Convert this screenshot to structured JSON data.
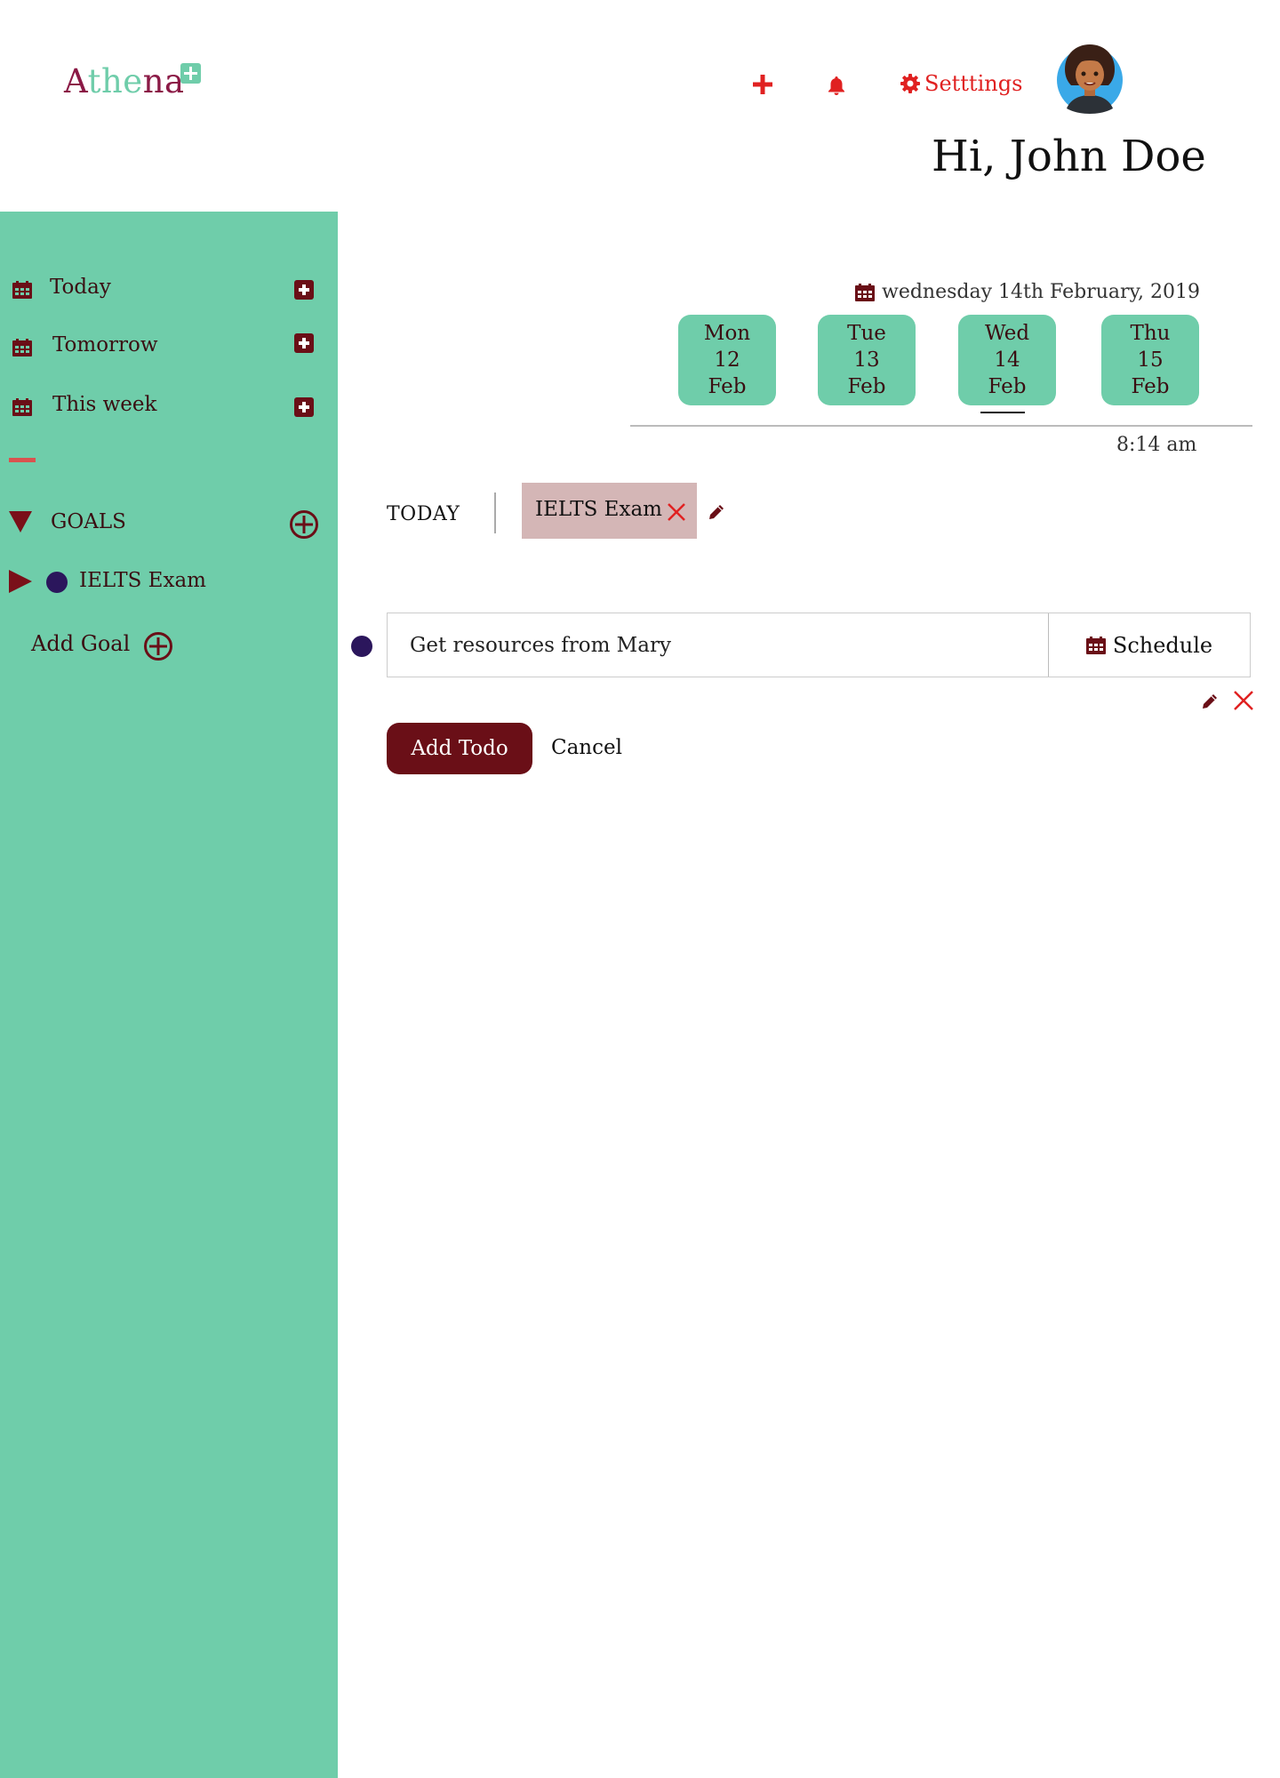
{
  "brand": {
    "logo_part1": "A",
    "logo_part2": "the",
    "logo_part3": "na"
  },
  "header": {
    "add_icon": "plus-icon",
    "notifications_icon": "bell-icon",
    "settings_label": "Setttings",
    "settings_icon": "gear-icon",
    "greeting": "Hi, John Doe"
  },
  "sidebar": {
    "items": [
      {
        "label": "Today",
        "icon": "calendar-icon"
      },
      {
        "label": "Tomorrow",
        "icon": "calendar-icon"
      },
      {
        "label": "This week",
        "icon": "calendar-icon"
      }
    ],
    "goals_label": "GOALS",
    "goals": [
      {
        "label": "IELTS Exam",
        "color": "#2b165c"
      }
    ],
    "add_goal_label": "Add Goal"
  },
  "main": {
    "current_date": "wednesday 14th February, 2019",
    "days": [
      {
        "dow": "Mon",
        "date": "12",
        "month": "Feb"
      },
      {
        "dow": "Tue",
        "date": "13",
        "month": "Feb"
      },
      {
        "dow": "Wed",
        "date": "14",
        "month": "Feb",
        "selected": true
      },
      {
        "dow": "Thu",
        "date": "15",
        "month": "Feb"
      }
    ],
    "time": "8:14 am",
    "today_label": "TODAY",
    "active_tag": "IELTS Exam",
    "todo": {
      "value": "Get resources from Mary",
      "schedule_label": "Schedule"
    },
    "add_todo_label": "Add Todo",
    "cancel_label": "Cancel"
  },
  "colors": {
    "sidebar": "#6fcdaa",
    "accent_dark": "#6a0f17",
    "alert_red": "#e02121",
    "tag_bg": "#d4b6b6",
    "goal_dot": "#2b165c",
    "logo_primary": "#8b1a46",
    "logo_secondary": "#6fcdaa"
  }
}
